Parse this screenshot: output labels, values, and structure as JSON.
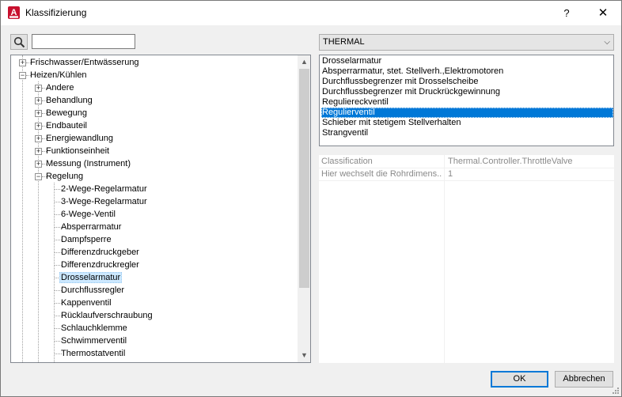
{
  "window": {
    "title": "Klassifizierung",
    "help_glyph": "?",
    "close_glyph": "✕"
  },
  "search": {
    "value": "",
    "placeholder": ""
  },
  "tree": {
    "items": [
      {
        "label": "Frischwasser/Entwässerung",
        "level": 0,
        "expander": "+"
      },
      {
        "label": "Heizen/Kühlen",
        "level": 0,
        "expander": "−"
      },
      {
        "label": "Andere",
        "level": 1,
        "expander": "+"
      },
      {
        "label": "Behandlung",
        "level": 1,
        "expander": "+"
      },
      {
        "label": "Bewegung",
        "level": 1,
        "expander": "+"
      },
      {
        "label": "Endbauteil",
        "level": 1,
        "expander": "+"
      },
      {
        "label": "Energiewandlung",
        "level": 1,
        "expander": "+"
      },
      {
        "label": "Funktionseinheit",
        "level": 1,
        "expander": "+"
      },
      {
        "label": "Messung (Instrument)",
        "level": 1,
        "expander": "+"
      },
      {
        "label": "Regelung",
        "level": 1,
        "expander": "−"
      },
      {
        "label": "2-Wege-Regelarmatur",
        "level": 2
      },
      {
        "label": "3-Wege-Regelarmatur",
        "level": 2
      },
      {
        "label": "6-Wege-Ventil",
        "level": 2
      },
      {
        "label": "Absperrarmatur",
        "level": 2
      },
      {
        "label": "Dampfsperre",
        "level": 2
      },
      {
        "label": "Differenzdruckgeber",
        "level": 2
      },
      {
        "label": "Differenzdruckregler",
        "level": 2
      },
      {
        "label": "Drosselarmatur",
        "level": 2,
        "selected": true
      },
      {
        "label": "Durchflussregler",
        "level": 2
      },
      {
        "label": "Kappenventil",
        "level": 2
      },
      {
        "label": "Rücklaufverschraubung",
        "level": 2
      },
      {
        "label": "Schlauchklemme",
        "level": 2
      },
      {
        "label": "Schwimmerventil",
        "level": 2
      },
      {
        "label": "Thermostatventil",
        "level": 2
      }
    ]
  },
  "dropdown": {
    "selected": "THERMAL"
  },
  "listbox": {
    "items": [
      "Drosselarmatur",
      "Absperrarmatur, stet. Stellverh.,Elektromotoren",
      "Durchflussbegrenzer mit Drosselscheibe",
      "Durchflussbegrenzer mit Druckrückgewinnung",
      "Reguliereckventil",
      "Regulierventil",
      "Schieber mit stetigem Stellverhalten",
      "Strangventil"
    ],
    "selected_index": 5
  },
  "properties": [
    {
      "key": "Classification",
      "value": "Thermal.Controller.ThrottleValve"
    },
    {
      "key": "Hier wechselt die Rohrdimens...",
      "value": "1"
    }
  ],
  "buttons": {
    "ok": "OK",
    "cancel": "Abbrechen"
  },
  "colors": {
    "accent": "#0078d7",
    "tree_selection": "#cce8ff",
    "brand": "#c8102e"
  }
}
